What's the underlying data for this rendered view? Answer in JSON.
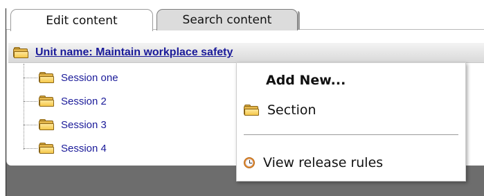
{
  "tabs": [
    {
      "label": "Edit content",
      "active": true
    },
    {
      "label": "Search content",
      "active": false
    }
  ],
  "unit": {
    "title": "Unit name: Maintain workplace safety",
    "icon": "folder-icon"
  },
  "sessions": [
    {
      "label": "Session one",
      "icon": "folder-icon"
    },
    {
      "label": "Session 2",
      "icon": "folder-icon"
    },
    {
      "label": "Session 3",
      "icon": "folder-icon"
    },
    {
      "label": "Session 4",
      "icon": "folder-icon"
    }
  ],
  "context_menu": {
    "heading": "Add New...",
    "items": [
      {
        "label": "Section",
        "icon": "folder-icon"
      },
      {
        "label": "View release rules",
        "icon": "clock-icon"
      }
    ]
  },
  "colors": {
    "link": "#1a1a99",
    "folder": "#e3b54a",
    "inactive_tab": "#dcdcdc",
    "background_area": "#6d6d6d"
  }
}
